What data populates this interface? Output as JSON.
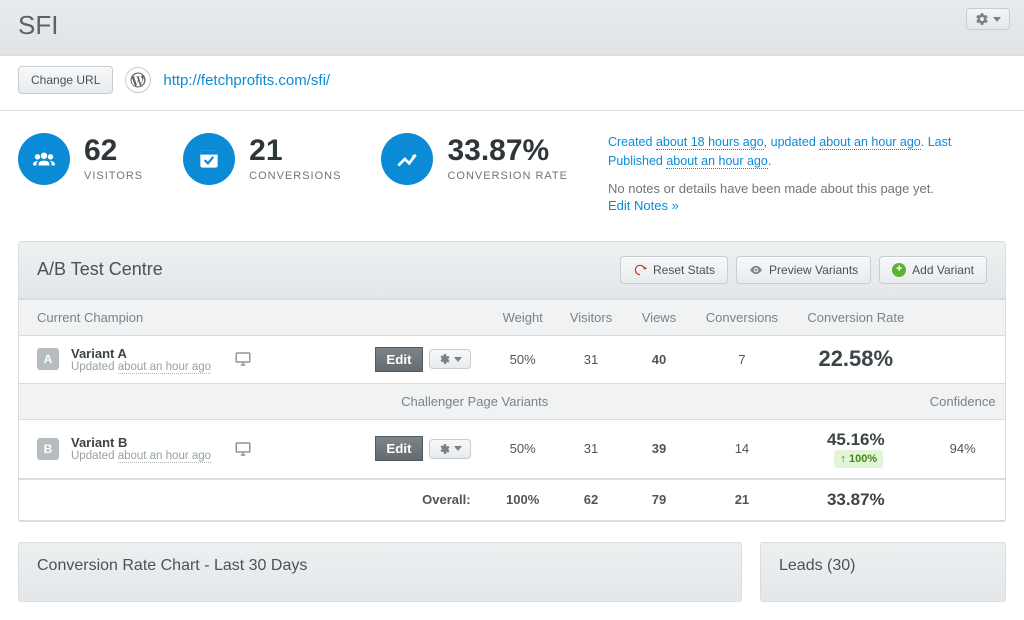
{
  "header": {
    "title": "SFI"
  },
  "url_bar": {
    "change_url_label": "Change URL",
    "url": "http://fetchprofits.com/sfi/"
  },
  "stats": {
    "visitors": {
      "value": "62",
      "label": "VISITORS"
    },
    "conversions": {
      "value": "21",
      "label": "CONVERSIONS"
    },
    "rate": {
      "value": "33.87%",
      "label": "CONVERSION RATE"
    }
  },
  "meta": {
    "created_prefix": "Created ",
    "created_ago": "about 18 hours ago",
    "updated_prefix": ", updated ",
    "updated_ago": "about an hour ago",
    "published_prefix": ". Last Published ",
    "published_ago": "about an hour ago",
    "suffix": ".",
    "no_notes": "No notes or details have been made about this page yet.",
    "edit_notes": "Edit Notes »"
  },
  "ab": {
    "title": "A/B Test Centre",
    "actions": {
      "reset": "Reset Stats",
      "preview": "Preview Variants",
      "add": "Add Variant"
    },
    "columns": {
      "champion": "Current Champion",
      "weight": "Weight",
      "visitors": "Visitors",
      "views": "Views",
      "conversions": "Conversions",
      "rate": "Conversion Rate",
      "confidence": "Confidence"
    },
    "challenger_label": "Challenger Page Variants",
    "edit_label": "Edit",
    "updated_prefix": "Updated ",
    "variant_a": {
      "badge": "A",
      "name": "Variant A",
      "updated": "about an hour ago",
      "weight": "50%",
      "visitors": "31",
      "views": "40",
      "conversions": "7",
      "rate": "22.58%"
    },
    "variant_b": {
      "badge": "B",
      "name": "Variant B",
      "updated": "about an hour ago",
      "weight": "50%",
      "visitors": "31",
      "views": "39",
      "conversions": "14",
      "rate": "45.16%",
      "lift": "↑ 100%",
      "confidence": "94%"
    },
    "overall": {
      "label": "Overall:",
      "weight": "100%",
      "visitors": "62",
      "views": "79",
      "conversions": "21",
      "rate": "33.87%"
    }
  },
  "bottom": {
    "chart_title": "Conversion Rate Chart - Last 30 Days",
    "leads_title": "Leads (30)"
  }
}
